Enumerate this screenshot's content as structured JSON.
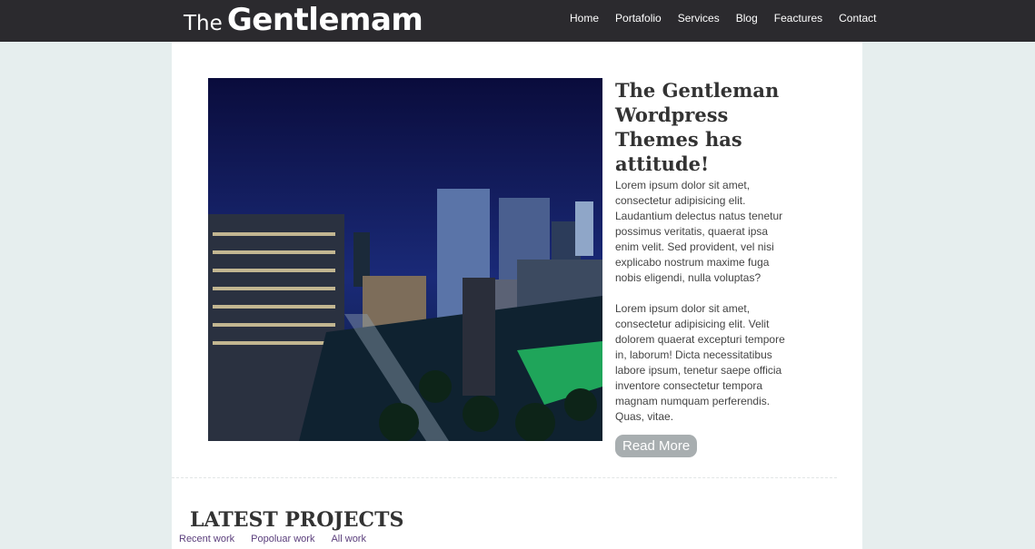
{
  "header": {
    "logo_prefix": "The",
    "logo_name": "Gentlemam",
    "nav": [
      "Home",
      "Portafolio",
      "Services",
      "Blog",
      "Feactures",
      "Contact"
    ]
  },
  "hero": {
    "image_alt": "city-at-night-photo",
    "title": "The Gentleman Wordpress Themes has attitude!",
    "paragraphs": [
      "Lorem ipsum dolor sit amet, consectetur adipisicing elit. Laudantium delectus natus tenetur possimus veritatis, quaerat ipsa enim velit. Sed provident, vel nisi explicabo nostrum maxime fuga nobis eligendi, nulla voluptas?",
      "Lorem ipsum dolor sit amet, consectetur adipisicing elit. Velit dolorem quaerat excepturi tempore in, laborum! Dicta necessitatibus labore ipsum, tenetur saepe officia inventore consectetur tempora magnam numquam perferendis. Quas, vitae."
    ],
    "button_label": "Read More"
  },
  "projects": {
    "title": "LATEST PROJECTS",
    "filters": [
      "Recent work",
      "Popoluar work",
      "All work"
    ]
  },
  "colors": {
    "topbar": "#2b2a2e",
    "page_bg": "#e6eeee",
    "button": "#a8aeb0",
    "filter_link": "#5b3f7c"
  }
}
